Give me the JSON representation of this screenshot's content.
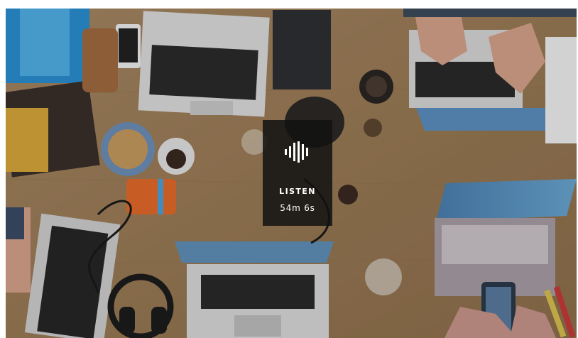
{
  "hero": {
    "image_alt": "",
    "podcast": {
      "label": "LISTEN",
      "duration": "54m 6s",
      "icon": "audio-waveform-icon"
    }
  },
  "colors": {
    "card_bg": "#121212",
    "card_text": "#ffffff",
    "table": "#c8a982"
  }
}
